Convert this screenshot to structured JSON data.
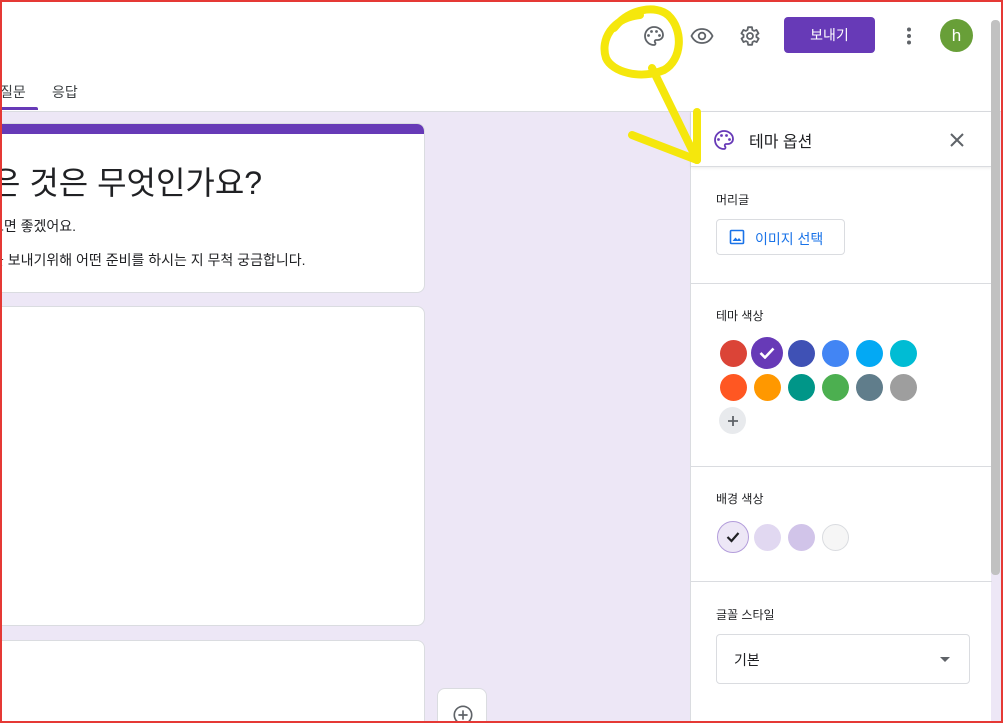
{
  "header": {
    "send_label": "보내기",
    "avatar_letter": "h",
    "icons": [
      "palette-icon",
      "eye-icon",
      "gear-icon",
      "more-vert-icon"
    ]
  },
  "tabs": [
    {
      "label": "질문",
      "active": true
    },
    {
      "label": "응답",
      "active": false
    }
  ],
  "form": {
    "title": "은 것은 무엇인가요?",
    "description_line1": "으면 좋겠어요.",
    "description_line2": "를 보내기위해 어떤 준비를 하시는 지 무척 궁금합니다."
  },
  "theme_panel": {
    "title": "테마 옵션",
    "header_section": {
      "label": "머리글",
      "image_button_label": "이미지 선택"
    },
    "theme_color": {
      "label": "테마 색상",
      "colors": [
        "#db4437",
        "#673ab7",
        "#3f51b5",
        "#4285f4",
        "#03a9f4",
        "#00bcd4",
        "#ff5722",
        "#ff9800",
        "#009688",
        "#4caf50",
        "#607d8b",
        "#9e9e9e"
      ],
      "selected_color": "#673ab7"
    },
    "background_color": {
      "label": "배경 색상",
      "colors": [
        "#ede7f6",
        "#e1d8f1",
        "#d1c4e9",
        "#f6f6f6"
      ],
      "selected_color": "#ede7f6"
    },
    "font_style": {
      "label": "글꼴 스타일",
      "selected": "기본"
    }
  },
  "colors": {
    "accent": "#673ab7",
    "annotation": "#f5e70c"
  }
}
